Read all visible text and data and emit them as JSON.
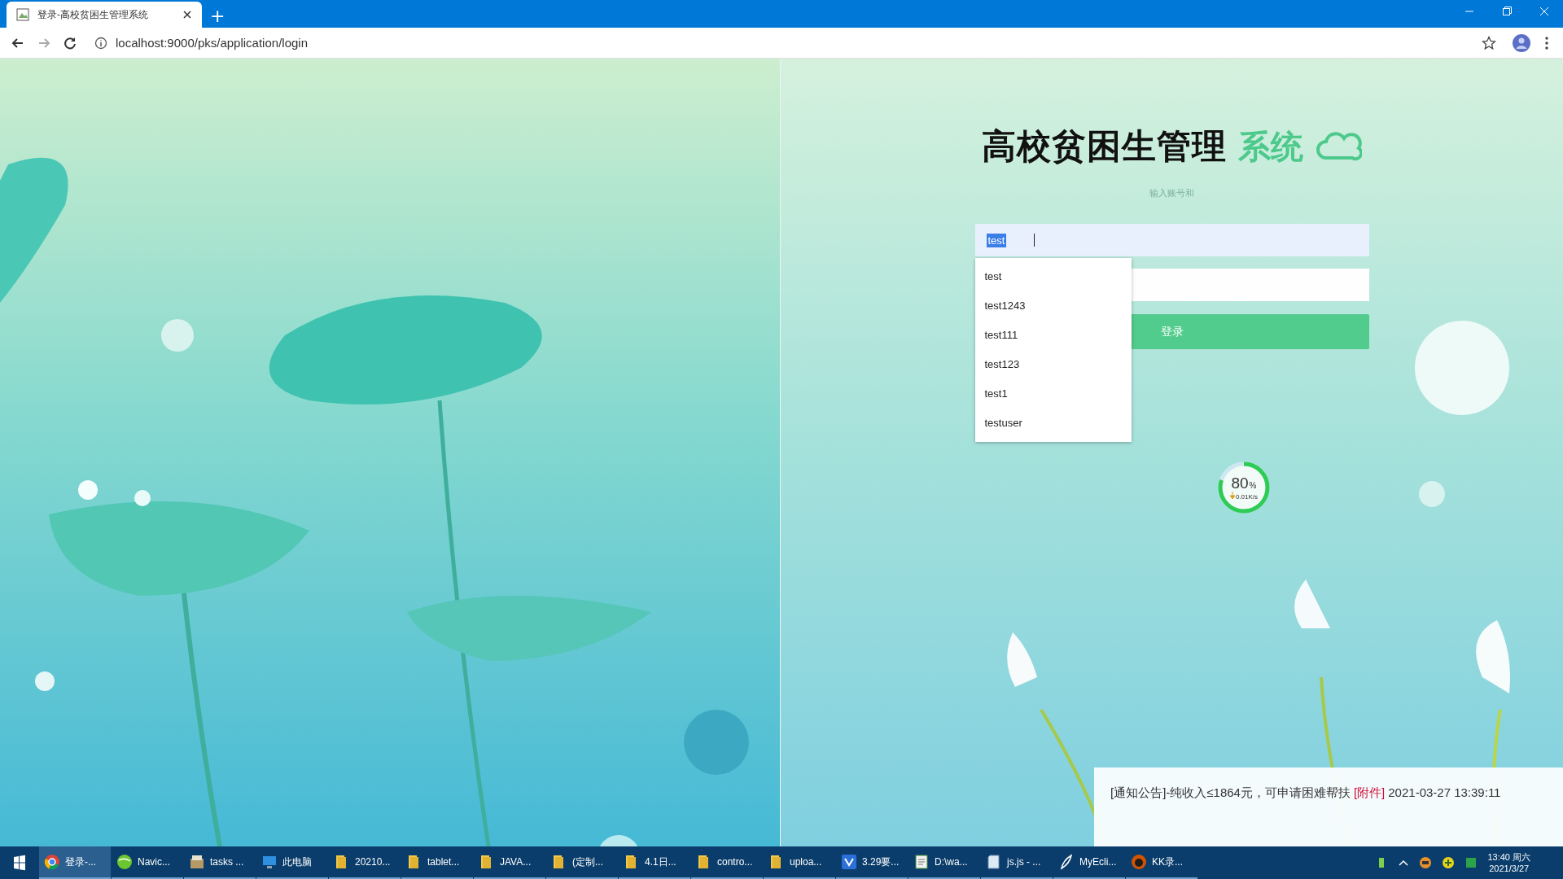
{
  "browser": {
    "tab": {
      "title": "登录-高校贫困生管理系统",
      "selected": true
    },
    "new_tab": "+",
    "url": "localhost:9000/pks/application/login"
  },
  "login": {
    "title": "高校贫困生管理",
    "title_accent": "系统",
    "subtitle": "输入账号和",
    "username": {
      "value": "test",
      "text_selected": true
    },
    "suggestions": [
      {
        "label": "test",
        "selected": false
      },
      {
        "label": "test1243",
        "selected": false
      },
      {
        "label": "test111",
        "selected": false
      },
      {
        "label": "test123",
        "selected": false
      },
      {
        "label": "test1",
        "selected": false
      },
      {
        "label": "testuser",
        "selected": false
      }
    ],
    "login_button": "登录"
  },
  "speed_widget": {
    "percent": "80",
    "unit": "%",
    "speed": "0.01K/s",
    "level": 0.8
  },
  "notice": {
    "text": "[通知公告]-纯收入≤1864元，可申请困难帮扶",
    "attachment": "[附件]",
    "time": "2021-03-27 13:39:11"
  },
  "taskbar": {
    "items": [
      {
        "kind": "browser",
        "label": "登录-...",
        "selected": true
      },
      {
        "kind": "ball",
        "label": "Navic...",
        "selected": false
      },
      {
        "kind": "box",
        "label": "tasks ...",
        "selected": false
      },
      {
        "kind": "monitor",
        "label": "此电脑",
        "selected": false
      },
      {
        "kind": "folder",
        "label": "20210...",
        "selected": false
      },
      {
        "kind": "folder",
        "label": "tablet...",
        "selected": false
      },
      {
        "kind": "folder",
        "label": "JAVA...",
        "selected": false
      },
      {
        "kind": "folder",
        "label": "(定制...",
        "selected": false
      },
      {
        "kind": "folder",
        "label": "4.1日...",
        "selected": false
      },
      {
        "kind": "folder",
        "label": "contro...",
        "selected": false
      },
      {
        "kind": "folder",
        "label": "uploa...",
        "selected": false
      },
      {
        "kind": "vs",
        "label": "3.29要...",
        "selected": false
      },
      {
        "kind": "notepad",
        "label": "D:\\wa...",
        "selected": false
      },
      {
        "kind": "doc",
        "label": "js.js - ...",
        "selected": false
      },
      {
        "kind": "feather",
        "label": "MyEcli...",
        "selected": false
      },
      {
        "kind": "face",
        "label": "KK录...",
        "selected": false
      }
    ],
    "clock": {
      "time": "13:40 周六",
      "date": "2021/3/27"
    }
  }
}
